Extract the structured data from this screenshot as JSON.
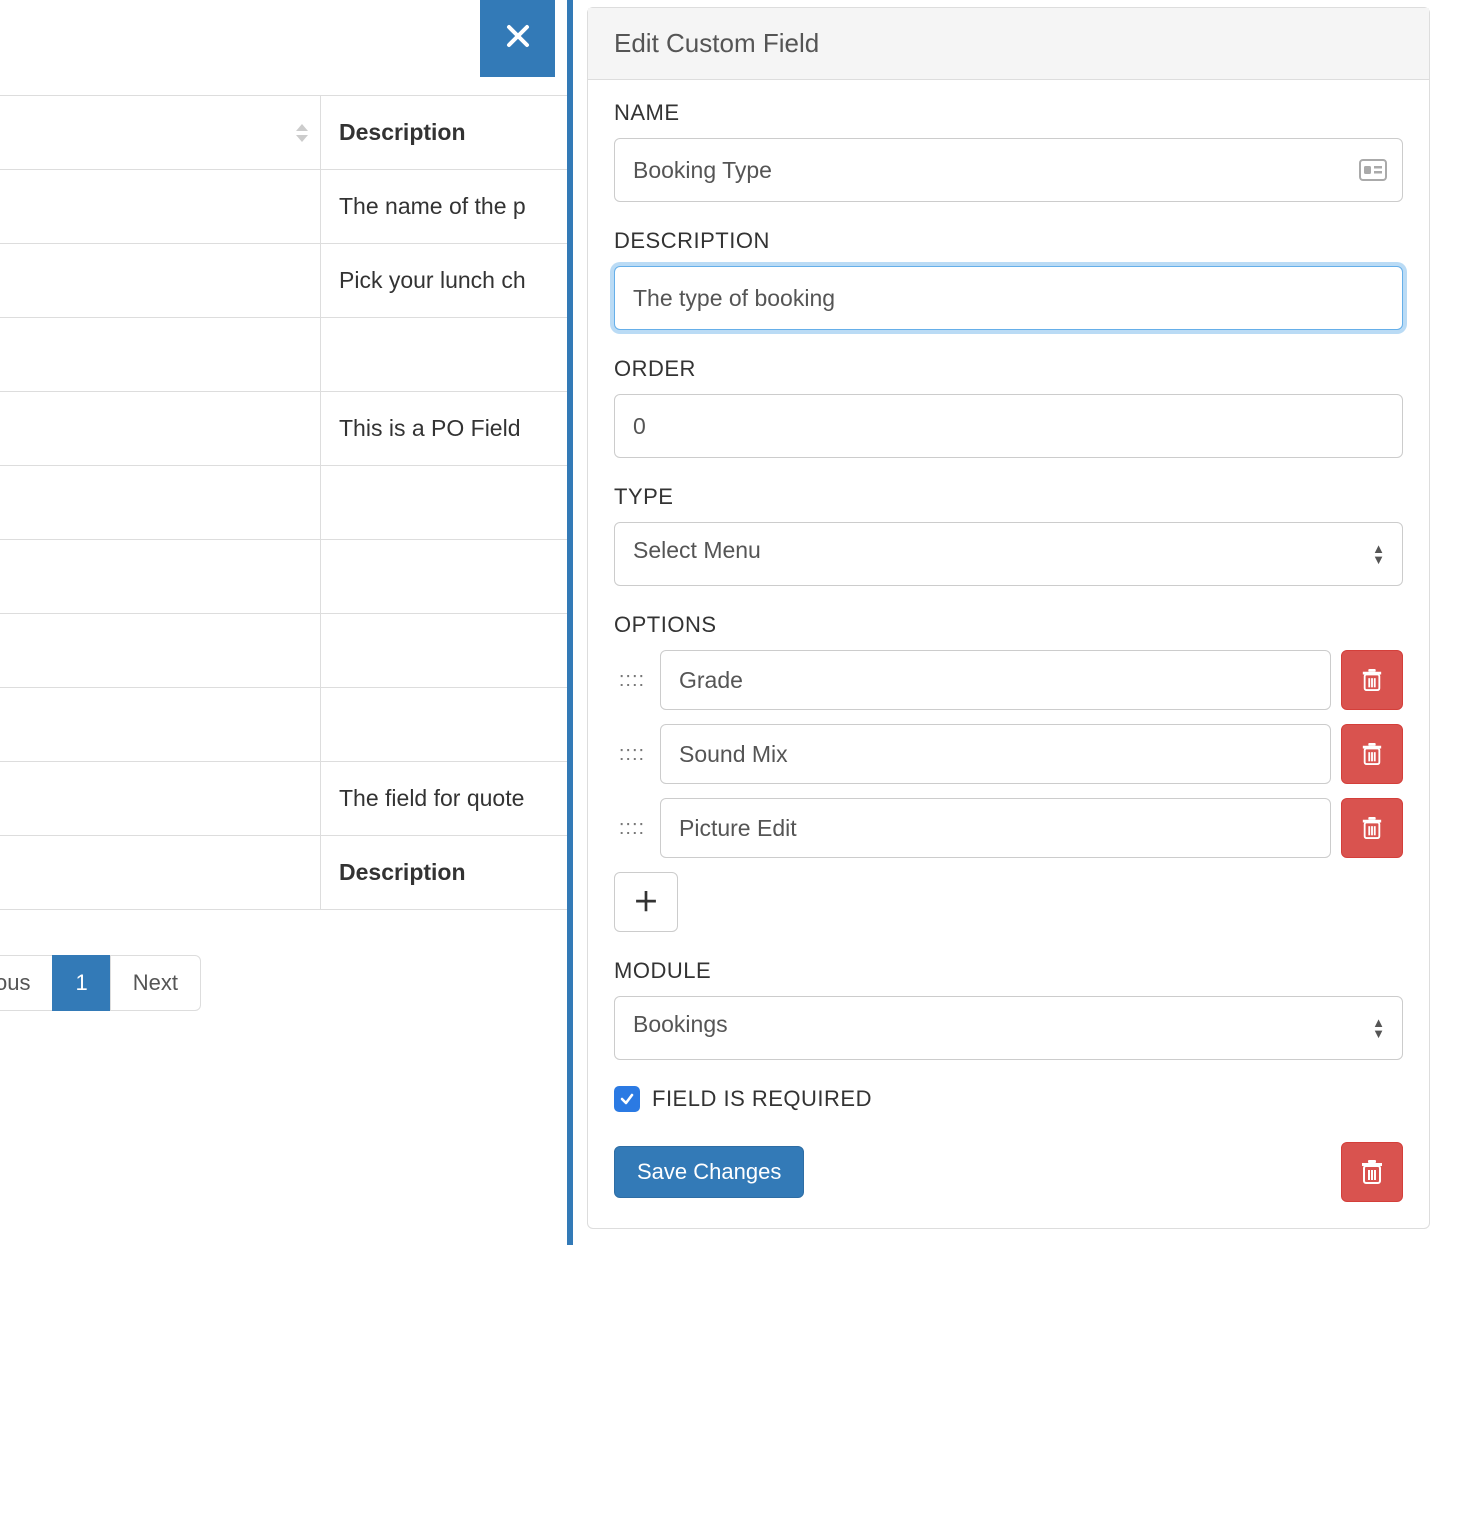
{
  "background_table": {
    "header_col1": "",
    "header_col2": "Description",
    "rows": [
      "The name of the p",
      "Pick your lunch ch",
      "",
      "This is a PO Field",
      "",
      "",
      "",
      "",
      "The field for quote"
    ],
    "footer_col2": "Description"
  },
  "pagination": {
    "previous_label": "Previous",
    "previous_truncated": "ous",
    "page1_label": "1",
    "next_label": "Next"
  },
  "panel": {
    "title": "Edit Custom Field",
    "name_label": "NAME",
    "name_value": "Booking Type",
    "description_label": "DESCRIPTION",
    "description_value": "The type of booking",
    "order_label": "ORDER",
    "order_value": "0",
    "type_label": "TYPE",
    "type_value": "Select Menu",
    "options_label": "OPTIONS",
    "options": [
      "Grade",
      "Sound Mix",
      "Picture Edit"
    ],
    "module_label": "MODULE",
    "module_value": "Bookings",
    "required_label": "FIELD IS REQUIRED",
    "required_checked": true,
    "save_label": "Save Changes"
  }
}
